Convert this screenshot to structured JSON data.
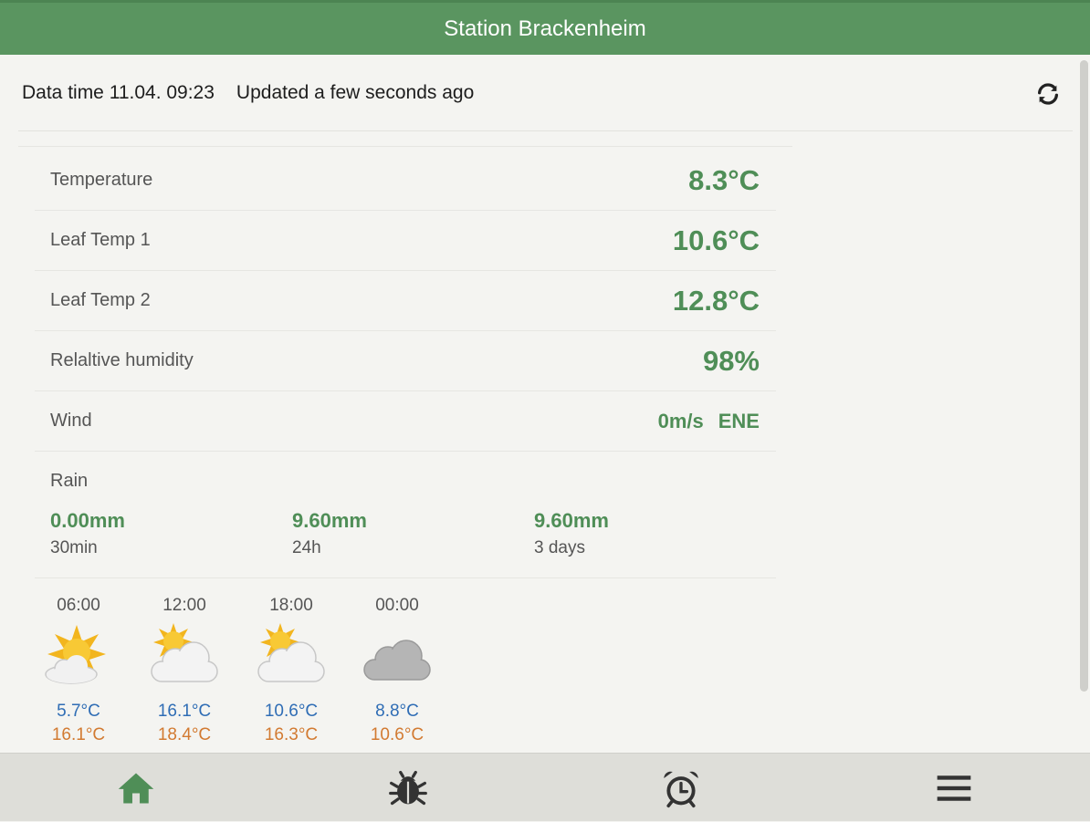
{
  "header": {
    "title": "Station Brackenheim"
  },
  "status": {
    "data_time": "Data time 11.04. 09:23",
    "updated": "Updated a few seconds ago",
    "refresh_icon": "refresh-icon"
  },
  "measurements": [
    {
      "label": "Temperature",
      "value": "8.3°C"
    },
    {
      "label": "Leaf Temp 1",
      "value": "10.6°C"
    },
    {
      "label": "Leaf Temp 2",
      "value": "12.8°C"
    },
    {
      "label": "Relaltive humidity",
      "value": "98%"
    }
  ],
  "wind": {
    "label": "Wind",
    "speed": "0m/s",
    "direction": "ENE"
  },
  "rain": {
    "label": "Rain",
    "periods": [
      {
        "amount": "0.00mm",
        "period": "30min"
      },
      {
        "amount": "9.60mm",
        "period": "24h"
      },
      {
        "amount": "9.60mm",
        "period": "3 days"
      }
    ]
  },
  "forecast": [
    {
      "time": "06:00",
      "icon": "sun-behind-small-cloud-icon",
      "tmin": "5.7°C",
      "tmax": "16.1°C"
    },
    {
      "time": "12:00",
      "icon": "sun-behind-cloud-icon",
      "tmin": "16.1°C",
      "tmax": "18.4°C"
    },
    {
      "time": "18:00",
      "icon": "sun-behind-cloud-icon",
      "tmin": "10.6°C",
      "tmax": "16.3°C"
    },
    {
      "time": "00:00",
      "icon": "cloud-icon",
      "tmin": "8.8°C",
      "tmax": "10.6°C"
    }
  ],
  "nav": {
    "items": [
      {
        "icon": "home-icon",
        "active": true
      },
      {
        "icon": "bug-icon",
        "active": false
      },
      {
        "icon": "alarm-clock-icon",
        "active": false
      },
      {
        "icon": "menu-icon",
        "active": false
      }
    ]
  },
  "colors": {
    "brand_green": "#5a9560",
    "value_green": "#4f8e57",
    "min_temp_blue": "#2f6db5",
    "max_temp_orange": "#d27a31",
    "nav_inactive": "#333333"
  }
}
